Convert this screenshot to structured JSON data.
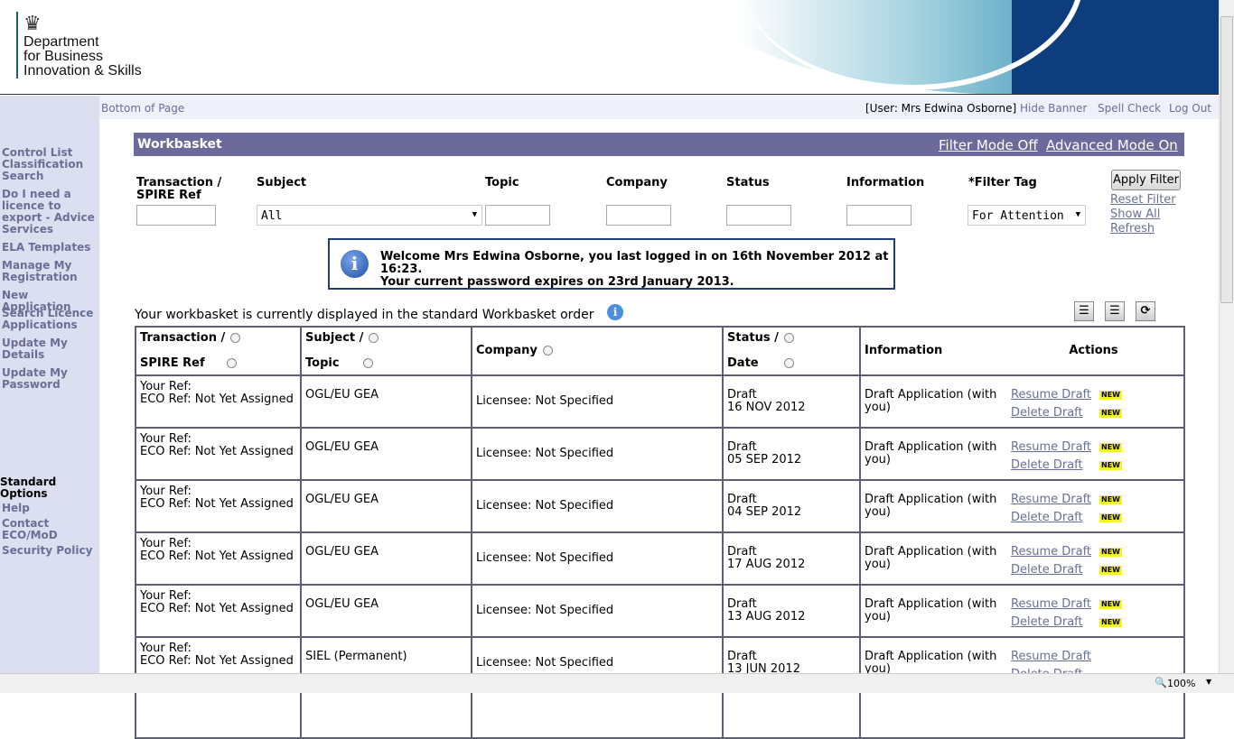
{
  "banner": {
    "org_line1": "Department",
    "org_line2": "for Business",
    "org_line3": "Innovation & Skills"
  },
  "sidebar": {
    "items": [
      "Control List Classification Search",
      "Do I need a licence to export - Advice Services",
      "ELA Templates",
      "Manage My Registration",
      "New Application",
      "Search Licence Applications",
      "Update My Details",
      "Update My Password"
    ],
    "standard_heading": "Standard Options",
    "standard_items": [
      "Help",
      "Contact ECO/MoD",
      "Security Policy"
    ]
  },
  "topbar": {
    "bottom": "Bottom of Page",
    "user": "[User: Mrs Edwina Osborne]",
    "hide": "Hide Banner",
    "spell": "Spell Check",
    "logout": "Log Out"
  },
  "workbasket": {
    "title": "Workbasket",
    "filter_mode": "Filter Mode Off",
    "advanced_mode": "Advanced Mode On"
  },
  "filters": {
    "labels": [
      "Transaction / SPIRE Ref",
      "Subject",
      "Topic",
      "Company",
      "Status",
      "Information",
      "*Filter Tag"
    ],
    "subject_value": "All",
    "filter_tag_value": "For Attention",
    "apply": "Apply Filter",
    "reset": "Reset Filter",
    "show_all": "Show All",
    "refresh": "Refresh"
  },
  "welcome": {
    "line1": "Welcome Mrs Edwina Osborne, you last logged in on 16th November 2012 at 16:23.",
    "line2": "Your current password expires on 23rd January 2013."
  },
  "order_text": "Your workbasket is currently displayed in the standard Workbasket order",
  "table": {
    "headers": {
      "ref1": "Transaction /",
      "ref2": "SPIRE Ref",
      "subj1": "Subject /",
      "subj2": "Topic",
      "company": "Company",
      "status1": "Status /",
      "status2": "Date",
      "info": "Information",
      "actions": "Actions"
    },
    "rows": [
      {
        "ref1": "Your Ref:",
        "ref2": "ECO Ref: Not Yet Assigned",
        "subject": "OGL/EU GEA",
        "company": "Licensee: Not Specified",
        "status": "Draft",
        "date": "16 NOV 2012",
        "info": "Draft Application (with you)",
        "resume": "Resume Draft",
        "delete": "Delete Draft",
        "badge": "NEW"
      },
      {
        "ref1": "Your Ref:",
        "ref2": "ECO Ref: Not Yet Assigned",
        "subject": "OGL/EU GEA",
        "company": "Licensee: Not Specified",
        "status": "Draft",
        "date": "05 SEP 2012",
        "info": "Draft Application (with you)",
        "resume": "Resume Draft",
        "delete": "Delete Draft",
        "badge": "NEW"
      },
      {
        "ref1": "Your Ref:",
        "ref2": "ECO Ref: Not Yet Assigned",
        "subject": "OGL/EU GEA",
        "company": "Licensee: Not Specified",
        "status": "Draft",
        "date": "04 SEP 2012",
        "info": "Draft Application (with you)",
        "resume": "Resume Draft",
        "delete": "Delete Draft",
        "badge": "NEW"
      },
      {
        "ref1": "Your Ref:",
        "ref2": "ECO Ref: Not Yet Assigned",
        "subject": "OGL/EU GEA",
        "company": "Licensee: Not Specified",
        "status": "Draft",
        "date": "17 AUG 2012",
        "info": "Draft Application (with you)",
        "resume": "Resume Draft",
        "delete": "Delete Draft",
        "badge": "NEW"
      },
      {
        "ref1": "Your Ref:",
        "ref2": "ECO Ref: Not Yet Assigned",
        "subject": "OGL/EU GEA",
        "company": "Licensee: Not Specified",
        "status": "Draft",
        "date": "13 AUG 2012",
        "info": "Draft Application (with you)",
        "resume": "Resume Draft",
        "delete": "Delete Draft",
        "badge": "NEW"
      },
      {
        "ref1": "Your Ref:",
        "ref2": "ECO Ref: Not Yet Assigned",
        "subject": "SIEL (Permanent)",
        "company": "Licensee: Not Specified",
        "status": "Draft",
        "date": "13 JUN 2012",
        "info": "Draft Application (with you)",
        "resume": "Resume Draft",
        "delete": "Delete Draft",
        "badge": ""
      }
    ]
  },
  "statusbar": {
    "zoom": "100%"
  }
}
